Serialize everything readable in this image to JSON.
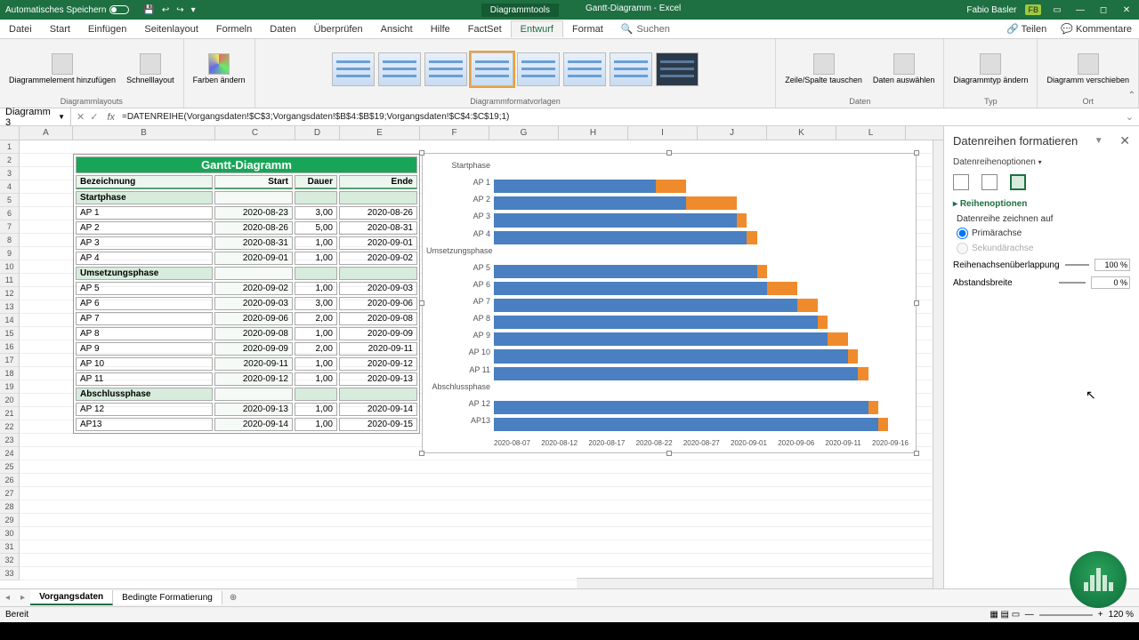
{
  "titlebar": {
    "autosave_label": "Automatisches Speichern",
    "tool_tab": "Diagrammtools",
    "doc_title": "Gantt-Diagramm - Excel",
    "user_name": "Fabio Basler",
    "user_initials": "FB"
  },
  "menu": {
    "tabs": [
      "Datei",
      "Start",
      "Einfügen",
      "Seitenlayout",
      "Formeln",
      "Daten",
      "Überprüfen",
      "Ansicht",
      "Hilfe",
      "FactSet",
      "Entwurf",
      "Format"
    ],
    "active": "Entwurf",
    "search_label": "Suchen",
    "share": "Teilen",
    "comments": "Kommentare"
  },
  "ribbon": {
    "g_layouts": "Diagrammlayouts",
    "btn_addel": "Diagrammelement hinzufügen",
    "btn_quick": "Schnelllayout",
    "btn_colors": "Farben ändern",
    "g_styles": "Diagrammformatvorlagen",
    "g_data": "Daten",
    "btn_switch": "Zeile/Spalte tauschen",
    "btn_select": "Daten auswählen",
    "g_type": "Typ",
    "btn_type": "Diagrammtyp ändern",
    "g_loc": "Ort",
    "btn_move": "Diagramm verschieben"
  },
  "namebox": "Diagramm 3",
  "formula": "=DATENREIHE(Vorgangsdaten!$C$3;Vorgangsdaten!$B$4:$B$19;Vorgangsdaten!$C$4:$C$19;1)",
  "columns": [
    "A",
    "B",
    "C",
    "D",
    "E",
    "F",
    "G",
    "H",
    "I",
    "J",
    "K",
    "L"
  ],
  "table": {
    "title": "Gantt-Diagramm",
    "headers": {
      "b": "Bezeichnung",
      "c": "Start",
      "d": "Dauer",
      "e": "Ende"
    },
    "rows": [
      {
        "type": "phase",
        "b": "Startphase"
      },
      {
        "type": "task",
        "b": "AP 1",
        "c": "2020-08-23",
        "d": "3,00",
        "e": "2020-08-26"
      },
      {
        "type": "task",
        "b": "AP 2",
        "c": "2020-08-26",
        "d": "5,00",
        "e": "2020-08-31"
      },
      {
        "type": "task",
        "b": "AP 3",
        "c": "2020-08-31",
        "d": "1,00",
        "e": "2020-09-01"
      },
      {
        "type": "task",
        "b": "AP 4",
        "c": "2020-09-01",
        "d": "1,00",
        "e": "2020-09-02"
      },
      {
        "type": "phase",
        "b": "Umsetzungsphase"
      },
      {
        "type": "task",
        "b": "AP 5",
        "c": "2020-09-02",
        "d": "1,00",
        "e": "2020-09-03"
      },
      {
        "type": "task",
        "b": "AP 6",
        "c": "2020-09-03",
        "d": "3,00",
        "e": "2020-09-06"
      },
      {
        "type": "task",
        "b": "AP 7",
        "c": "2020-09-06",
        "d": "2,00",
        "e": "2020-09-08"
      },
      {
        "type": "task",
        "b": "AP 8",
        "c": "2020-09-08",
        "d": "1,00",
        "e": "2020-09-09"
      },
      {
        "type": "task",
        "b": "AP 9",
        "c": "2020-09-09",
        "d": "2,00",
        "e": "2020-09-11"
      },
      {
        "type": "task",
        "b": "AP 10",
        "c": "2020-09-11",
        "d": "1,00",
        "e": "2020-09-12"
      },
      {
        "type": "task",
        "b": "AP 11",
        "c": "2020-09-12",
        "d": "1,00",
        "e": "2020-09-13"
      },
      {
        "type": "phase",
        "b": "Abschlussphase"
      },
      {
        "type": "task",
        "b": "AP 12",
        "c": "2020-09-13",
        "d": "1,00",
        "e": "2020-09-14"
      },
      {
        "type": "task",
        "b": "AP13",
        "c": "2020-09-14",
        "d": "1,00",
        "e": "2020-09-15"
      }
    ]
  },
  "chart_data": {
    "type": "bar",
    "orientation": "horizontal",
    "stacked": true,
    "title": "",
    "xlabel": "",
    "ylabel": "",
    "x_ticks": [
      "2020-08-07",
      "2020-08-12",
      "2020-08-17",
      "2020-08-22",
      "2020-08-27",
      "2020-09-01",
      "2020-09-06",
      "2020-09-11",
      "2020-09-16"
    ],
    "x_range_days": {
      "min": "2020-08-07",
      "max": "2020-09-17",
      "span": 41
    },
    "categories": [
      "Startphase",
      "AP 1",
      "AP 2",
      "AP 3",
      "AP 4",
      "Umsetzungsphase",
      "AP 5",
      "AP 6",
      "AP 7",
      "AP 8",
      "AP 9",
      "AP 10",
      "AP 11",
      "Abschlussphase",
      "AP 12",
      "AP13"
    ],
    "series": [
      {
        "name": "Start",
        "role": "offset_days_from_2020-08-07",
        "color": "#4a7fc1",
        "values": [
          null,
          16,
          19,
          24,
          25,
          null,
          26,
          27,
          30,
          32,
          33,
          35,
          36,
          null,
          37,
          38
        ]
      },
      {
        "name": "Dauer",
        "role": "duration_days",
        "color": "#ef8b2c",
        "values": [
          null,
          3,
          5,
          1,
          1,
          null,
          1,
          3,
          2,
          1,
          2,
          1,
          1,
          null,
          1,
          1
        ]
      }
    ]
  },
  "pane": {
    "title": "Datenreihen formatieren",
    "subtitle": "Datenreihenoptionen",
    "section": "Reihenoptionen",
    "plot_on": "Datenreihe zeichnen auf",
    "primary": "Primärachse",
    "secondary": "Sekundärachse",
    "overlap_label": "Reihenachsenüberlappung",
    "overlap_value": "100 %",
    "gap_label": "Abstandsbreite",
    "gap_value": "0 %"
  },
  "sheets": {
    "active": "Vorgangsdaten",
    "other": "Bedingte Formatierung"
  },
  "status": {
    "ready": "Bereit",
    "zoom": "120 %"
  }
}
